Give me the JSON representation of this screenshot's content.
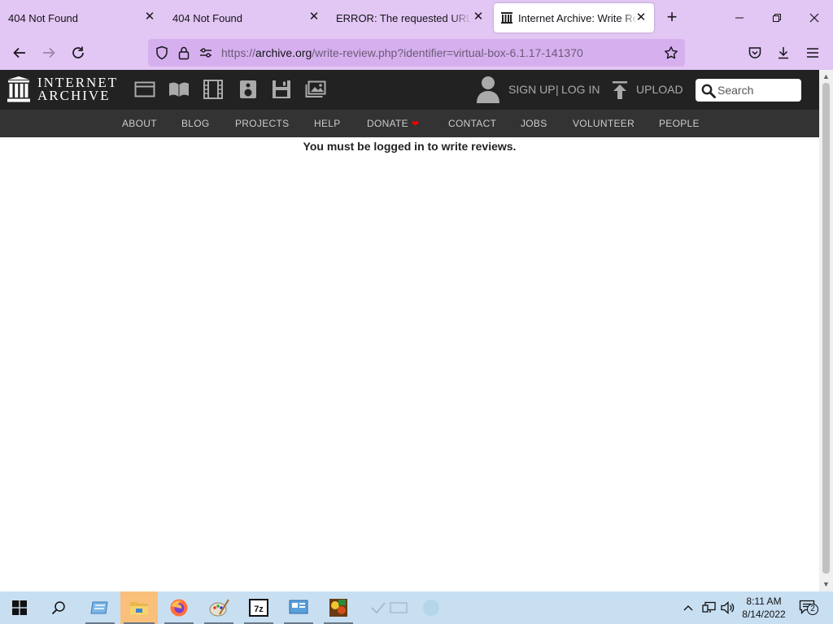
{
  "browser": {
    "tabs": [
      {
        "title": "404 Not Found",
        "active": false
      },
      {
        "title": "404 Not Found",
        "active": false
      },
      {
        "title": "ERROR: The requested URL could",
        "active": false
      },
      {
        "title": "Internet Archive: Write Revi",
        "active": true
      }
    ],
    "new_tab_label": "+",
    "url": {
      "scheme": "https://",
      "domain": "archive.org",
      "path": "/write-review.php?identifier=virtual-box-6.1.17-141370"
    }
  },
  "site": {
    "logo_line1": "INTERNET",
    "logo_line2": "ARCHIVE",
    "media_icons": [
      "web-icon",
      "texts-icon",
      "video-icon",
      "audio-icon",
      "software-icon",
      "images-icon"
    ],
    "signup": "SIGN UP",
    "separator": "|",
    "login": "LOG IN",
    "upload": "UPLOAD",
    "search_placeholder": "Search",
    "nav": [
      "ABOUT",
      "BLOG",
      "PROJECTS",
      "HELP",
      "DONATE",
      "CONTACT",
      "JOBS",
      "VOLUNTEER",
      "PEOPLE"
    ],
    "donate_heart": "❤",
    "message": "You must be logged in to write reviews."
  },
  "taskbar": {
    "apps": [
      "start-icon",
      "search-icon",
      "control-panel-icon",
      "file-explorer-icon",
      "firefox-icon",
      "paint-icon",
      "7zip-icon",
      "system-info-icon",
      "game-icon",
      "hidden-app-icon",
      "hidden-app-icon",
      "hidden-app-icon"
    ],
    "time": "8:11 AM",
    "date": "8/14/2022",
    "notification_count": "2"
  },
  "colors": {
    "browser_chrome": "#e2c6f3",
    "ia_header": "#222222",
    "ia_subnav": "#333333",
    "taskbar": "#c8dff2"
  }
}
